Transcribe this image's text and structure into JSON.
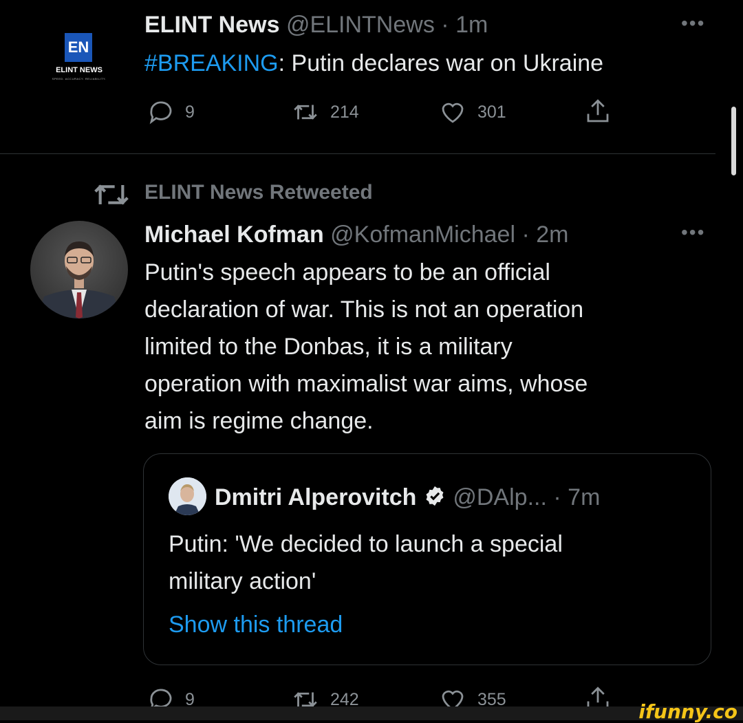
{
  "tweet1": {
    "logo": {
      "mark": "EN",
      "name": "ELINT NEWS",
      "tagline": "SPEED. ACCURACY. RELIABILITY."
    },
    "name": "ELINT News",
    "handle": "@ELINTNews",
    "time": "1m",
    "hashtag": "#BREAKING",
    "text": ": Putin declares war on Ukraine",
    "replies": "9",
    "retweets": "214",
    "likes": "301"
  },
  "retweet_banner": {
    "label": "ELINT News Retweeted"
  },
  "tweet2": {
    "name": "Michael Kofman",
    "handle": "@KofmanMichael",
    "time": "2m",
    "lines": [
      "Putin's speech appears to be an official",
      "declaration of war. This is not an operation",
      "limited to the Donbas, it is a military",
      "operation with maximalist war aims, whose",
      "aim is regime change."
    ],
    "quote": {
      "name": "Dmitri Alperovitch",
      "handle": "@DAlp...",
      "time": "7m",
      "lines": [
        "Putin: 'We decided to launch a special",
        "military action'"
      ],
      "link": "Show this thread"
    },
    "replies": "9",
    "retweets": "242",
    "likes": "355"
  },
  "separator": "·",
  "watermark": "ifunny.co",
  "colors": {
    "background": "#000000",
    "text": "#e7e9ea",
    "muted": "#71767b",
    "link": "#1d9bf0",
    "verified": "#e7e9ea"
  },
  "icons": [
    "reply-icon",
    "retweet-icon",
    "like-icon",
    "share-icon",
    "more-icon",
    "verified-icon"
  ]
}
